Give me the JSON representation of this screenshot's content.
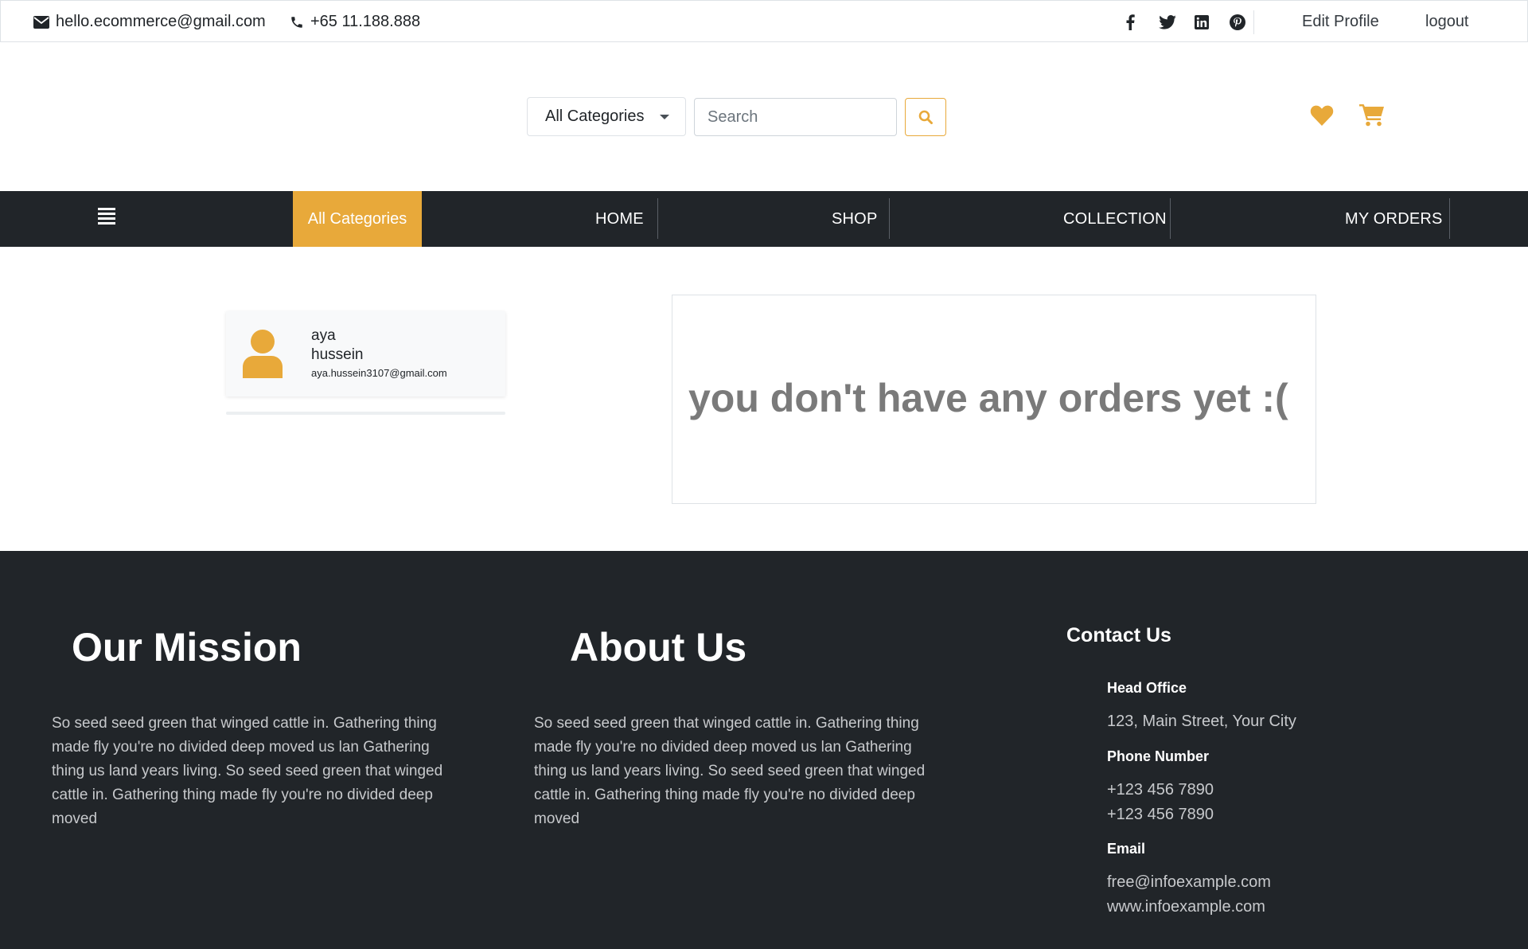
{
  "topbar": {
    "email": "hello.ecommerce@gmail.com",
    "phone": "+65 11.188.888",
    "social_icons": [
      "facebook-icon",
      "twitter-icon",
      "linkedin-icon",
      "pinterest-icon"
    ],
    "edit_profile": "Edit Profile",
    "logout": "logout"
  },
  "search": {
    "category_selected": "All Categories",
    "placeholder": "Search"
  },
  "nav": {
    "all_categories": "All Categories",
    "items": [
      "HOME",
      "SHOP",
      "COLLECTION",
      "MY ORDERS"
    ]
  },
  "profile": {
    "first_name": "aya",
    "last_name": "hussein",
    "email": "aya.hussein3107@gmail.com"
  },
  "orders": {
    "empty_message": "you don't have any orders yet :("
  },
  "footer": {
    "mission": {
      "title": "Our Mission",
      "text": "So seed seed green that winged cattle in. Gathering thing made fly you're no divided deep moved us lan Gathering thing us land years living. So seed seed green that winged cattle in. Gathering thing made fly you're no divided deep moved"
    },
    "about": {
      "title": "About Us",
      "text": "So seed seed green that winged cattle in. Gathering thing made fly you're no divided deep moved us lan Gathering thing us land years living. So seed seed green that winged cattle in. Gathering thing made fly you're no divided deep moved"
    },
    "contact": {
      "title": "Contact Us",
      "head_office_label": "Head Office",
      "head_office": "123, Main Street, Your City",
      "phone_label": "Phone Number",
      "phone_1": "+123 456 7890",
      "phone_2": "+123 456 7890",
      "email_label": "Email",
      "email": "free@infoexample.com",
      "website": "www.infoexample.com"
    }
  },
  "colors": {
    "accent": "#e8a93a",
    "dark": "#212529"
  }
}
